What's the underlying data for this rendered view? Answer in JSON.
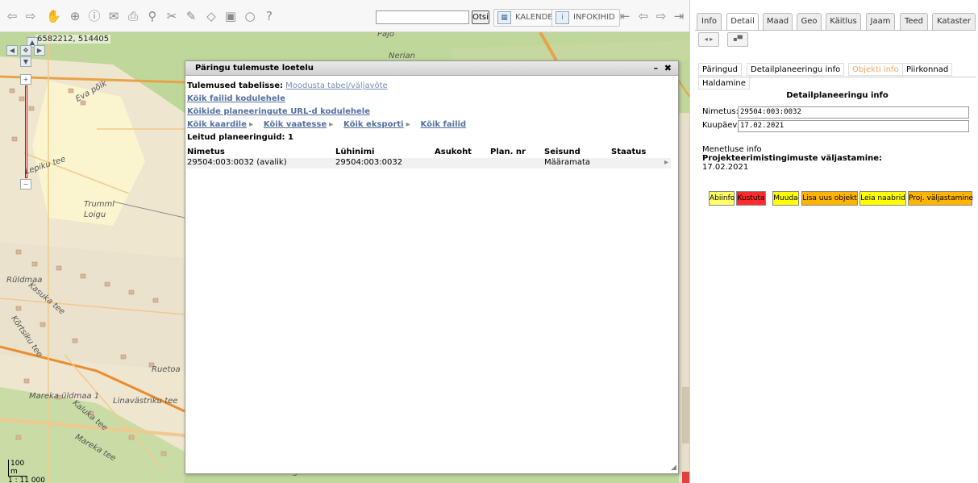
{
  "toolbar": {
    "icons": [
      "back-arrow-icon",
      "forward-arrow-icon",
      "hand-pan-icon",
      "zoom-search-icon",
      "info-icon",
      "mail-icon",
      "print-icon",
      "link-icon",
      "measure-icon",
      "draw-icon",
      "eraser-icon",
      "export-map-icon",
      "refresh-icon",
      "help-icon"
    ],
    "search_placeholder": "",
    "search_button": "Otsi",
    "calendar_label": "KALENDER",
    "infokihid_label": "INFOKIHID"
  },
  "map": {
    "coords": "6582212, 514405",
    "labels": [
      "Pajo",
      "Nerian",
      "Eva põik",
      "Lepiku tee",
      "Trummi",
      "Loigu",
      "Rüldmaa",
      "Kasuka tee",
      "Kõrtsiku tee",
      "Ruetoa",
      "Mareka üldmaa 1",
      "Linavästriku tee",
      "Kaluka tee",
      "Mareka tee",
      "Ooe-Rangru"
    ],
    "scale_value": "100",
    "scale_unit": "m",
    "scale_ratio": "1 : 11 000",
    "zoom_plus": "+",
    "zoom_minus": "−"
  },
  "dialog": {
    "title": "Päringu tulemuste loetelu",
    "minimize": "–",
    "close": "✖",
    "export_label": "Tulemused tabelisse:",
    "export_link": "Moodusta tabel/väljavõte",
    "link_files": "Kõik failid kodulehele",
    "link_urls": "Kõikide planeeringute URL-d kodulehele",
    "actions": [
      {
        "label": "Kõik kaardile",
        "arrow": "▸"
      },
      {
        "label": "Kõik vaatesse",
        "arrow": "▸"
      },
      {
        "label": "Kõik eksporti",
        "arrow": "▸"
      },
      {
        "label": "Kõik failid",
        "arrow": ""
      }
    ],
    "found_label": "Leitud planeeringuid: 1",
    "columns": [
      "Nimetus",
      "Lühinimi",
      "Asukoht",
      "Plan. nr",
      "Seisund",
      "Staatus"
    ],
    "rows": [
      {
        "nimetus": "29504:003:0032 (avalik)",
        "luhinimi": "29504:003:0032",
        "asukoht": "",
        "plan_nr": "",
        "seisund": "Määramata",
        "staatus": "",
        "arrow": "▸"
      }
    ]
  },
  "panel": {
    "tabs": [
      "Info",
      "Detail",
      "Maad",
      "Geo",
      "Käitlus",
      "Jaam",
      "Teed",
      "Kataster"
    ],
    "active_tab": "Detail",
    "subnav": [
      "Päringud",
      "Detailplaneeringu info",
      "Objekti info",
      "Piirkonnad",
      "Haldamine"
    ],
    "section_title": "Detailplaneeringu info",
    "nimetus_label": "Nimetus:",
    "nimetus_value": "29504:003:0032",
    "kuupaev_label": "Kuupäev:",
    "kuupaev_value": "17.02.2021",
    "menetluse_info": "Menetluse info",
    "proj_label": "Projekteerimistingimuste väljastamine:",
    "proj_date": "17.02.2021",
    "action_buttons": [
      {
        "label": "Abiinfo",
        "color": "#ffff66"
      },
      {
        "label": "Kustuta",
        "color": "#ff2a2a"
      },
      {
        "label": "Muuda",
        "color": "#ffff00"
      },
      {
        "label": "Lisa uus objekt",
        "color": "#ffb400"
      },
      {
        "label": "Leia naabrid",
        "color": "#ffff00"
      },
      {
        "label": "Proj. väljastamine",
        "color": "#ffb400"
      }
    ]
  }
}
